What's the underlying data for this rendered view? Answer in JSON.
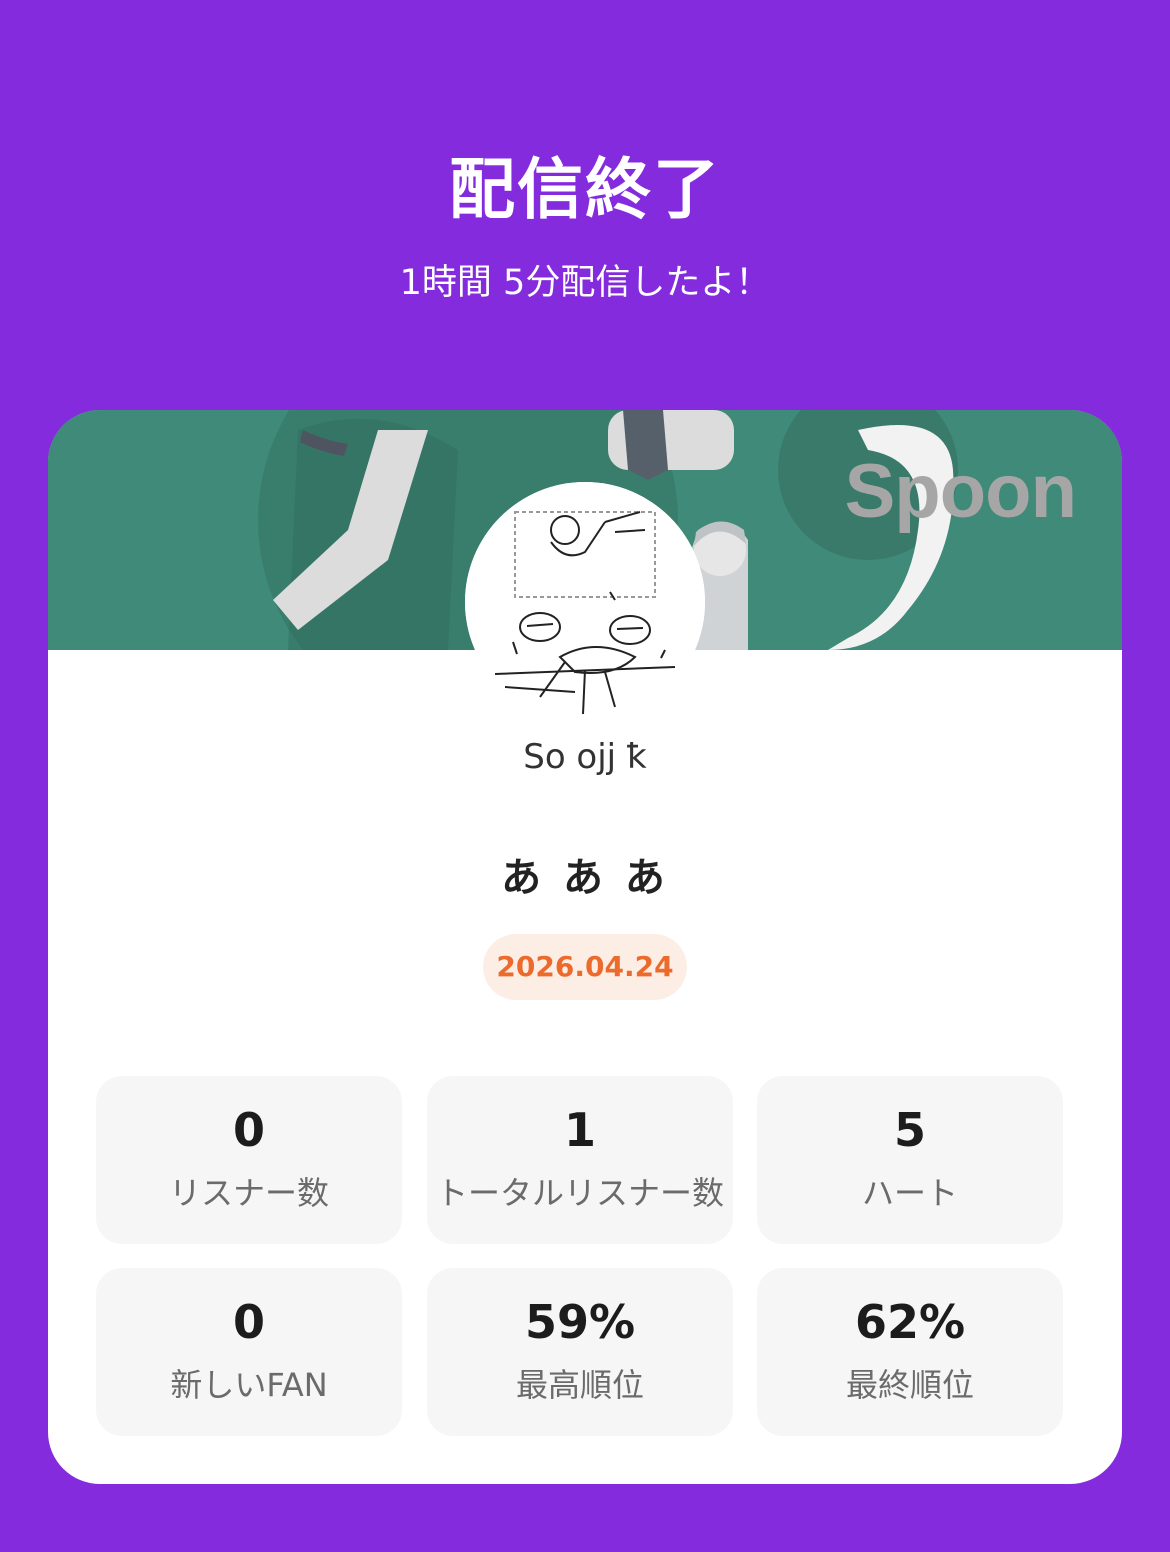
{
  "header": {
    "title": "配信終了",
    "subtitle": "1時間 5分配信したよ！"
  },
  "banner": {
    "logo_text": "Spoon",
    "background_color": "#3f8a78"
  },
  "host": {
    "name": "So ojj ꝁ"
  },
  "live": {
    "title": "あ あ あ",
    "date": "2026.04.24"
  },
  "stats": [
    {
      "value": "0",
      "label": "リスナー数"
    },
    {
      "value": "1",
      "label": "トータルリスナー数"
    },
    {
      "value": "5",
      "label": "ハート"
    },
    {
      "value": "0",
      "label": "新しいFAN"
    },
    {
      "value": "59%",
      "label": "最高順位"
    },
    {
      "value": "62%",
      "label": "最終順位"
    }
  ],
  "colors": {
    "background": "#852bde",
    "card": "#ffffff",
    "date_text": "#ec6a2c",
    "date_badge": "#fdeee5",
    "stat_box": "#f6f6f6"
  }
}
